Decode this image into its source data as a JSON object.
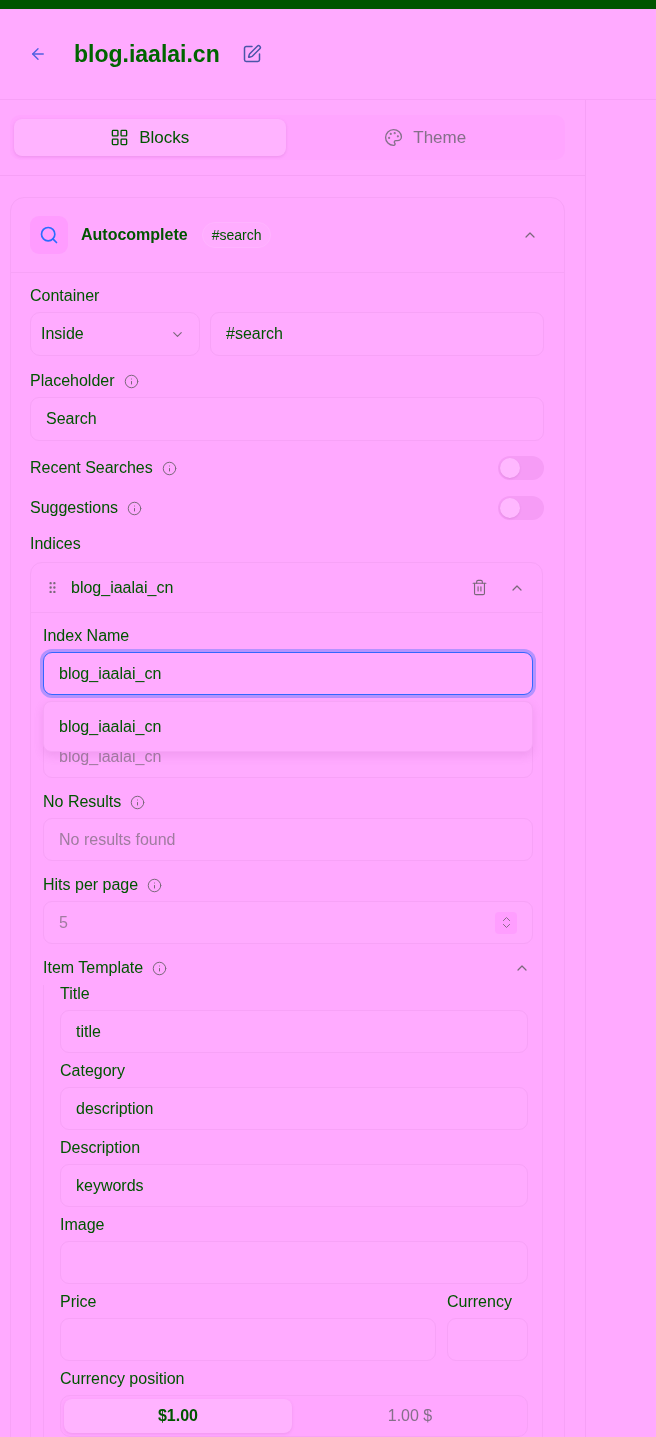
{
  "header": {
    "title": "blog.iaalai.cn"
  },
  "tabs": [
    {
      "label": "Blocks",
      "selected": true
    },
    {
      "label": "Theme",
      "selected": false
    }
  ],
  "block": {
    "title": "Autocomplete",
    "badge": "#search",
    "expanded": true,
    "container": {
      "label": "Container",
      "mode": "Inside",
      "selector": "#search"
    },
    "placeholder_setting": {
      "label": "Placeholder",
      "info": true,
      "value": "Search"
    },
    "toggles": [
      {
        "label": "Recent Searches",
        "info": true,
        "on": false
      },
      {
        "label": "Suggestions",
        "info": true,
        "on": false
      }
    ],
    "indices": {
      "label": "Indices",
      "items": [
        {
          "name": "blog_iaalai_cn",
          "expanded": true,
          "fields": [
            {
              "kind": "text",
              "label": "Index Name",
              "value": "blog_iaalai_cn",
              "focused": true,
              "suggestions": [
                "blog_iaalai_cn"
              ]
            },
            {
              "kind": "text",
              "placeholder": "blog_iaalai_cn"
            },
            {
              "kind": "text",
              "label": "No Results",
              "info": true,
              "placeholder": "No results found"
            },
            {
              "kind": "number",
              "label": "Hits per page",
              "info": true,
              "placeholder": "5"
            },
            {
              "kind": "group",
              "label": "Item Template",
              "info": true,
              "expanded": true,
              "fields": [
                {
                  "kind": "text",
                  "label": "Title",
                  "value": "title"
                },
                {
                  "kind": "text",
                  "label": "Category",
                  "value": "description"
                },
                {
                  "kind": "text",
                  "label": "Description",
                  "value": "keywords"
                },
                {
                  "kind": "text",
                  "label": "Image"
                },
                {
                  "kind": "pair",
                  "fields": [
                    {
                      "kind": "text",
                      "label": "Price"
                    },
                    {
                      "kind": "text",
                      "label": "Currency"
                    }
                  ]
                },
                {
                  "kind": "segmented",
                  "label": "Currency position",
                  "options": [
                    {
                      "label": "$1.00",
                      "selected": true
                    },
                    {
                      "label": "1.00 $",
                      "selected": false
                    }
                  ]
                }
              ]
            }
          ]
        }
      ]
    }
  }
}
